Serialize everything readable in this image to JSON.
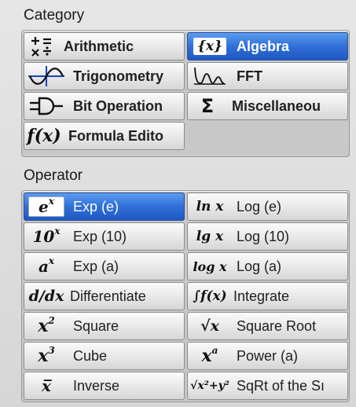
{
  "category": {
    "title": "Category",
    "items": [
      {
        "label": "Arithmetic",
        "icon": "plus-minus-times-divide-icon",
        "selected": false
      },
      {
        "label": "Algebra",
        "icon": "curly-x-icon",
        "icon_text": "{x}",
        "selected": true
      },
      {
        "label": "Trigonometry",
        "icon": "sine-wave-icon",
        "selected": false
      },
      {
        "label": "FFT",
        "icon": "fft-spectrum-icon",
        "selected": false
      },
      {
        "label": "Bit Operation",
        "icon": "logic-gate-icon",
        "selected": false
      },
      {
        "label": "Miscellaneou",
        "icon": "sigma-icon",
        "icon_text": "Σ",
        "selected": false
      },
      {
        "label": "Formula Edito",
        "icon": "function-fx-icon",
        "icon_text": "f(x)",
        "selected": false
      }
    ]
  },
  "operator": {
    "title": "Operator",
    "items": [
      {
        "label": "Exp (e)",
        "icon_text": "e",
        "icon_sup": "x",
        "selected": true
      },
      {
        "label": "Log (e)",
        "icon_text": "ln x",
        "selected": false
      },
      {
        "label": "Exp (10)",
        "icon_text": "10",
        "icon_sup": "x",
        "selected": false
      },
      {
        "label": "Log (10)",
        "icon_text": "lg x",
        "selected": false
      },
      {
        "label": "Exp (a)",
        "icon_text": "a",
        "icon_sup": "x",
        "selected": false
      },
      {
        "label": "Log (a)",
        "icon_text": "log x",
        "selected": false
      },
      {
        "label": "Differentiate",
        "icon_text": "d/dx",
        "selected": false
      },
      {
        "label": "Integrate",
        "icon_text": "∫f(x)",
        "selected": false
      },
      {
        "label": "Square",
        "icon_text": "x",
        "icon_sup": "2",
        "selected": false
      },
      {
        "label": "Square Root",
        "icon_text": "√x",
        "selected": false
      },
      {
        "label": "Cube",
        "icon_text": "x",
        "icon_sup": "3",
        "selected": false
      },
      {
        "label": "Power (a)",
        "icon_text": "x",
        "icon_sup": "a",
        "selected": false
      },
      {
        "label": "Inverse",
        "icon_text": "x̅",
        "selected": false
      },
      {
        "label": "SqRt of the Sı",
        "icon_text": "√x²+y²",
        "selected": false
      }
    ]
  },
  "colors": {
    "selected": "#2f6fd8",
    "background": "#dcdcdc"
  }
}
